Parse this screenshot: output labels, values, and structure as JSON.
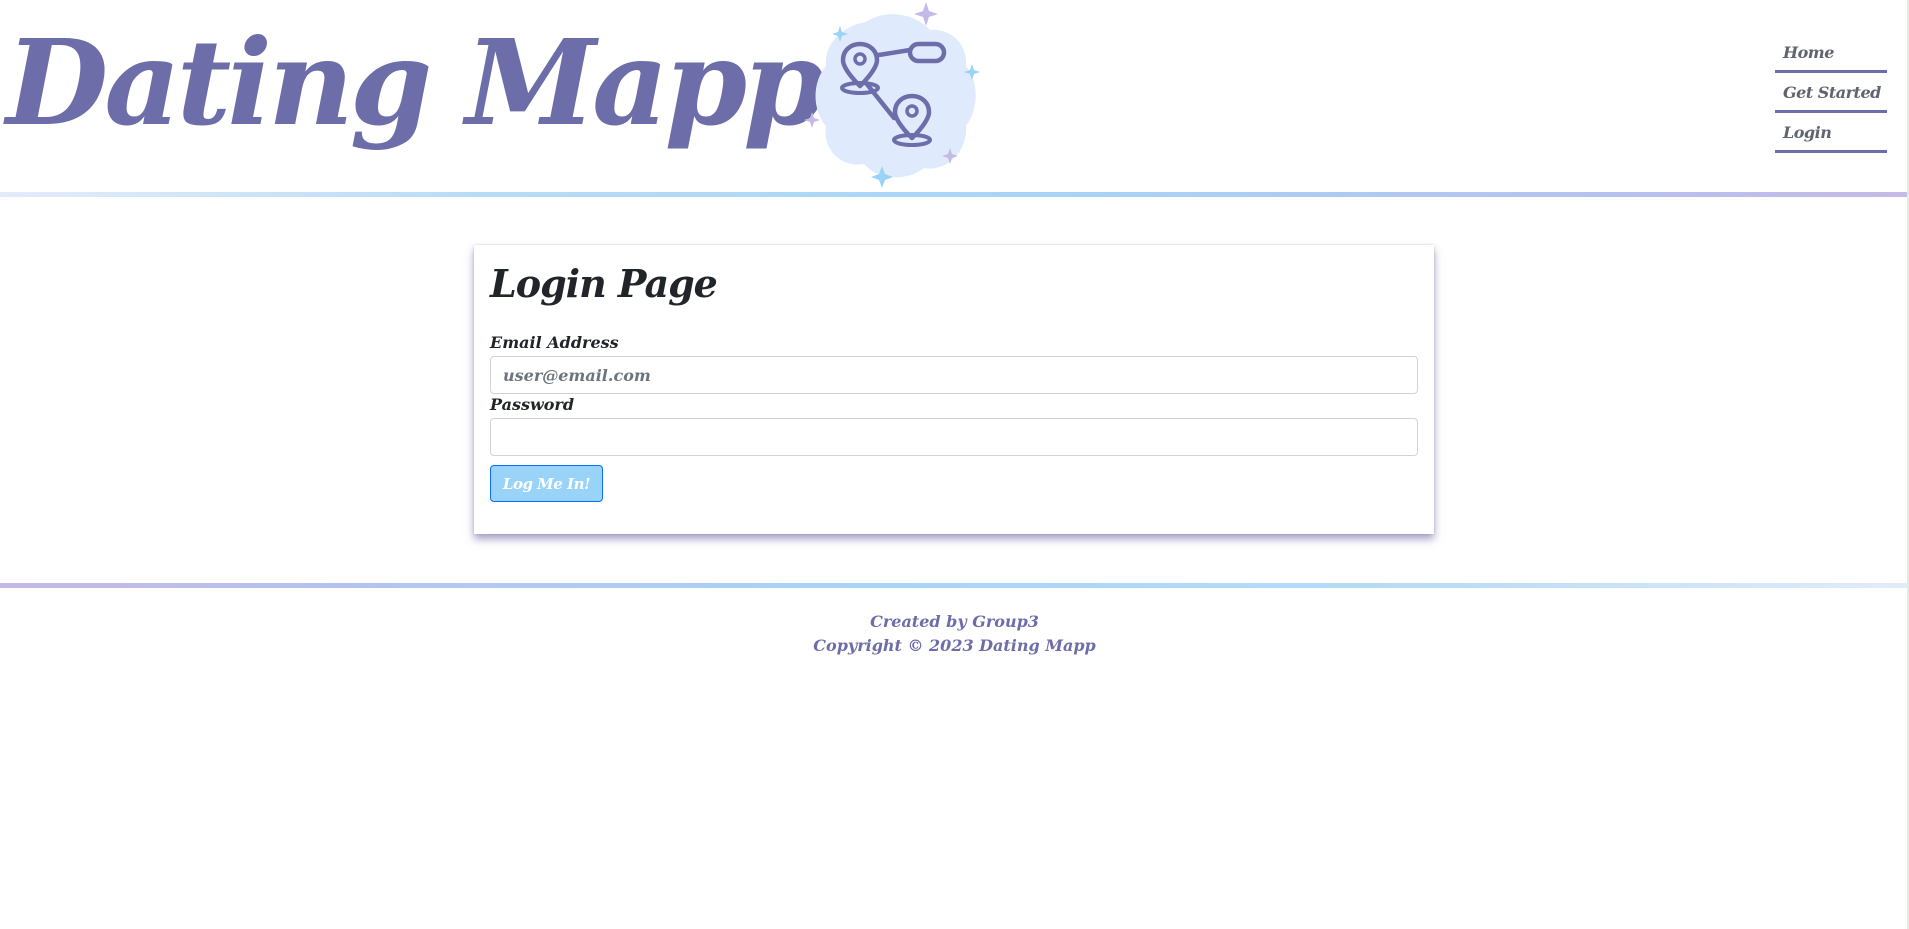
{
  "header": {
    "brand": "Dating Mapp",
    "logo_icon": "map-route-pins-icon"
  },
  "nav": {
    "items": [
      {
        "label": "Home"
      },
      {
        "label": "Get Started"
      },
      {
        "label": "Login"
      }
    ]
  },
  "login": {
    "title": "Login Page",
    "email_label": "Email Address",
    "email_placeholder": "user@email.com",
    "email_value": "",
    "password_label": "Password",
    "password_value": "",
    "submit_label": "Log Me In!"
  },
  "footer": {
    "credit": "Created by Group3",
    "copyright": "Copyright © 2023 Dating Mapp"
  },
  "colors": {
    "brand": "#6d6daa",
    "logo_blob": "#dfeafc",
    "sparkle_blue": "#9ad3f8",
    "sparkle_purple": "#c5b9e8",
    "button_bg": "#9ad3f8",
    "button_border": "#0d6efd"
  }
}
